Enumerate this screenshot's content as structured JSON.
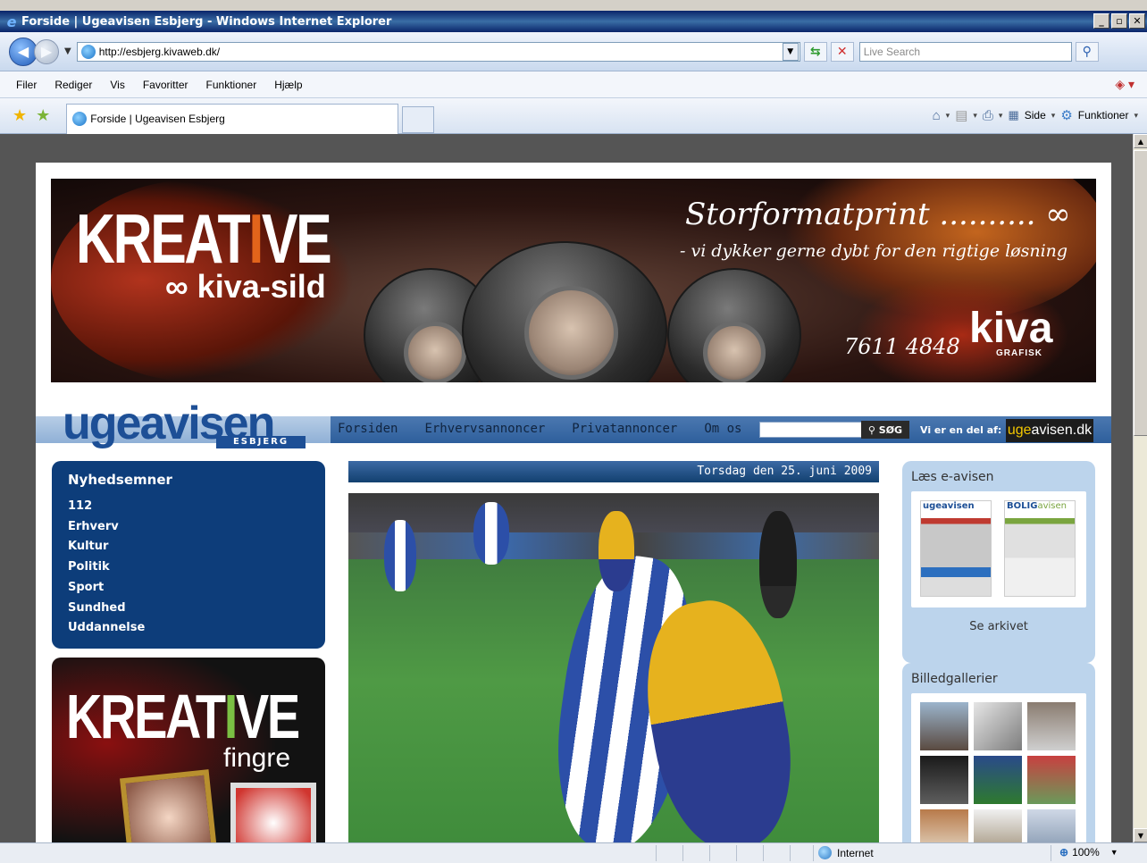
{
  "window": {
    "title": "Forside | Ugeavisen Esbjerg - Windows Internet Explorer"
  },
  "address": {
    "url": "http://esbjerg.kivaweb.dk/",
    "search_placeholder": "Live Search"
  },
  "menu": [
    "Filer",
    "Rediger",
    "Vis",
    "Favoritter",
    "Funktioner",
    "Hjælp"
  ],
  "tab": {
    "title": "Forside | Ugeavisen Esbjerg"
  },
  "commandbar": {
    "page": "Side",
    "tools": "Funktioner"
  },
  "banner": {
    "brand_pre": "KREAT",
    "brand_i": "I",
    "brand_post": "VE",
    "sub": "∞ kiva-sild",
    "tagline": "Storformatprint .......... ∞",
    "tagline2": "- vi dykker gerne dybt for den rigtige løsning",
    "phone": "7611 4848",
    "company": "kiva",
    "company_sub": "GRAFISK"
  },
  "site": {
    "logo": "ugeavisen",
    "logo_sub": "ESBJERG",
    "nav": [
      "Forsiden",
      "Erhvervsannoncer",
      "Privatannoncer",
      "Om os"
    ],
    "search_button": "SØG",
    "part_of": "Vi er en del af:",
    "partner_pre": "uge",
    "partner_post": "avisen.dk"
  },
  "news": {
    "title": "Nyhedsemner",
    "items": [
      "112",
      "Erhverv",
      "Kultur",
      "Politik",
      "Sport",
      "Sundhed",
      "Uddannelse"
    ]
  },
  "ad_left": {
    "pre": "KREAT",
    "i": "I",
    "post": "VE",
    "sub": "fingre"
  },
  "date": "Torsdag den 25. juni 2009",
  "right": {
    "eavis_title": "Læs e-avisen",
    "eavis_link": "Se arkivet",
    "paper1": "ugeavisen",
    "paper2_pre": "BOLIG",
    "paper2_post": "avisen",
    "gallery_title": "Billedgallerier"
  },
  "status": {
    "zone": "Internet",
    "zoom": "100%"
  }
}
